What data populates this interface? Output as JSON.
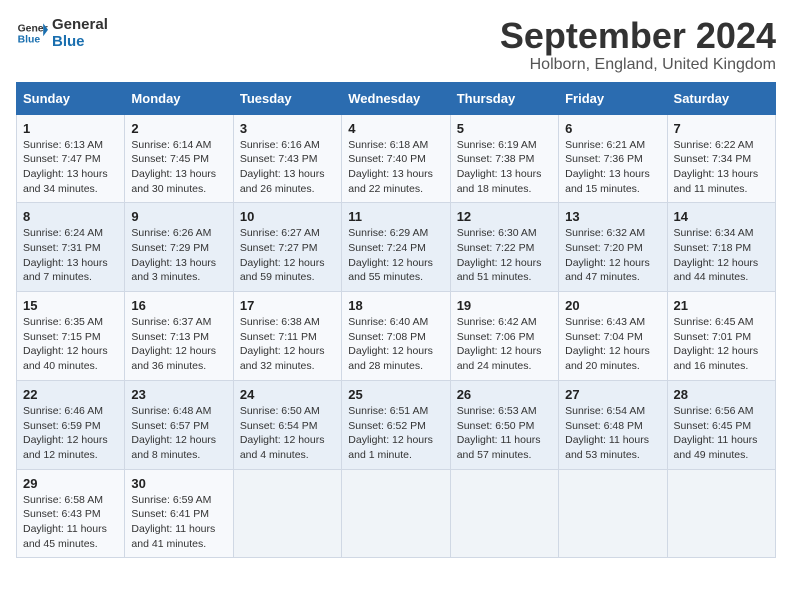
{
  "header": {
    "logo_line1": "General",
    "logo_line2": "Blue",
    "title": "September 2024",
    "subtitle": "Holborn, England, United Kingdom"
  },
  "days_of_week": [
    "Sunday",
    "Monday",
    "Tuesday",
    "Wednesday",
    "Thursday",
    "Friday",
    "Saturday"
  ],
  "weeks": [
    [
      {
        "day": "1",
        "info": "Sunrise: 6:13 AM\nSunset: 7:47 PM\nDaylight: 13 hours and 34 minutes."
      },
      {
        "day": "2",
        "info": "Sunrise: 6:14 AM\nSunset: 7:45 PM\nDaylight: 13 hours and 30 minutes."
      },
      {
        "day": "3",
        "info": "Sunrise: 6:16 AM\nSunset: 7:43 PM\nDaylight: 13 hours and 26 minutes."
      },
      {
        "day": "4",
        "info": "Sunrise: 6:18 AM\nSunset: 7:40 PM\nDaylight: 13 hours and 22 minutes."
      },
      {
        "day": "5",
        "info": "Sunrise: 6:19 AM\nSunset: 7:38 PM\nDaylight: 13 hours and 18 minutes."
      },
      {
        "day": "6",
        "info": "Sunrise: 6:21 AM\nSunset: 7:36 PM\nDaylight: 13 hours and 15 minutes."
      },
      {
        "day": "7",
        "info": "Sunrise: 6:22 AM\nSunset: 7:34 PM\nDaylight: 13 hours and 11 minutes."
      }
    ],
    [
      {
        "day": "8",
        "info": "Sunrise: 6:24 AM\nSunset: 7:31 PM\nDaylight: 13 hours and 7 minutes."
      },
      {
        "day": "9",
        "info": "Sunrise: 6:26 AM\nSunset: 7:29 PM\nDaylight: 13 hours and 3 minutes."
      },
      {
        "day": "10",
        "info": "Sunrise: 6:27 AM\nSunset: 7:27 PM\nDaylight: 12 hours and 59 minutes."
      },
      {
        "day": "11",
        "info": "Sunrise: 6:29 AM\nSunset: 7:24 PM\nDaylight: 12 hours and 55 minutes."
      },
      {
        "day": "12",
        "info": "Sunrise: 6:30 AM\nSunset: 7:22 PM\nDaylight: 12 hours and 51 minutes."
      },
      {
        "day": "13",
        "info": "Sunrise: 6:32 AM\nSunset: 7:20 PM\nDaylight: 12 hours and 47 minutes."
      },
      {
        "day": "14",
        "info": "Sunrise: 6:34 AM\nSunset: 7:18 PM\nDaylight: 12 hours and 44 minutes."
      }
    ],
    [
      {
        "day": "15",
        "info": "Sunrise: 6:35 AM\nSunset: 7:15 PM\nDaylight: 12 hours and 40 minutes."
      },
      {
        "day": "16",
        "info": "Sunrise: 6:37 AM\nSunset: 7:13 PM\nDaylight: 12 hours and 36 minutes."
      },
      {
        "day": "17",
        "info": "Sunrise: 6:38 AM\nSunset: 7:11 PM\nDaylight: 12 hours and 32 minutes."
      },
      {
        "day": "18",
        "info": "Sunrise: 6:40 AM\nSunset: 7:08 PM\nDaylight: 12 hours and 28 minutes."
      },
      {
        "day": "19",
        "info": "Sunrise: 6:42 AM\nSunset: 7:06 PM\nDaylight: 12 hours and 24 minutes."
      },
      {
        "day": "20",
        "info": "Sunrise: 6:43 AM\nSunset: 7:04 PM\nDaylight: 12 hours and 20 minutes."
      },
      {
        "day": "21",
        "info": "Sunrise: 6:45 AM\nSunset: 7:01 PM\nDaylight: 12 hours and 16 minutes."
      }
    ],
    [
      {
        "day": "22",
        "info": "Sunrise: 6:46 AM\nSunset: 6:59 PM\nDaylight: 12 hours and 12 minutes."
      },
      {
        "day": "23",
        "info": "Sunrise: 6:48 AM\nSunset: 6:57 PM\nDaylight: 12 hours and 8 minutes."
      },
      {
        "day": "24",
        "info": "Sunrise: 6:50 AM\nSunset: 6:54 PM\nDaylight: 12 hours and 4 minutes."
      },
      {
        "day": "25",
        "info": "Sunrise: 6:51 AM\nSunset: 6:52 PM\nDaylight: 12 hours and 1 minute."
      },
      {
        "day": "26",
        "info": "Sunrise: 6:53 AM\nSunset: 6:50 PM\nDaylight: 11 hours and 57 minutes."
      },
      {
        "day": "27",
        "info": "Sunrise: 6:54 AM\nSunset: 6:48 PM\nDaylight: 11 hours and 53 minutes."
      },
      {
        "day": "28",
        "info": "Sunrise: 6:56 AM\nSunset: 6:45 PM\nDaylight: 11 hours and 49 minutes."
      }
    ],
    [
      {
        "day": "29",
        "info": "Sunrise: 6:58 AM\nSunset: 6:43 PM\nDaylight: 11 hours and 45 minutes."
      },
      {
        "day": "30",
        "info": "Sunrise: 6:59 AM\nSunset: 6:41 PM\nDaylight: 11 hours and 41 minutes."
      },
      null,
      null,
      null,
      null,
      null
    ]
  ]
}
